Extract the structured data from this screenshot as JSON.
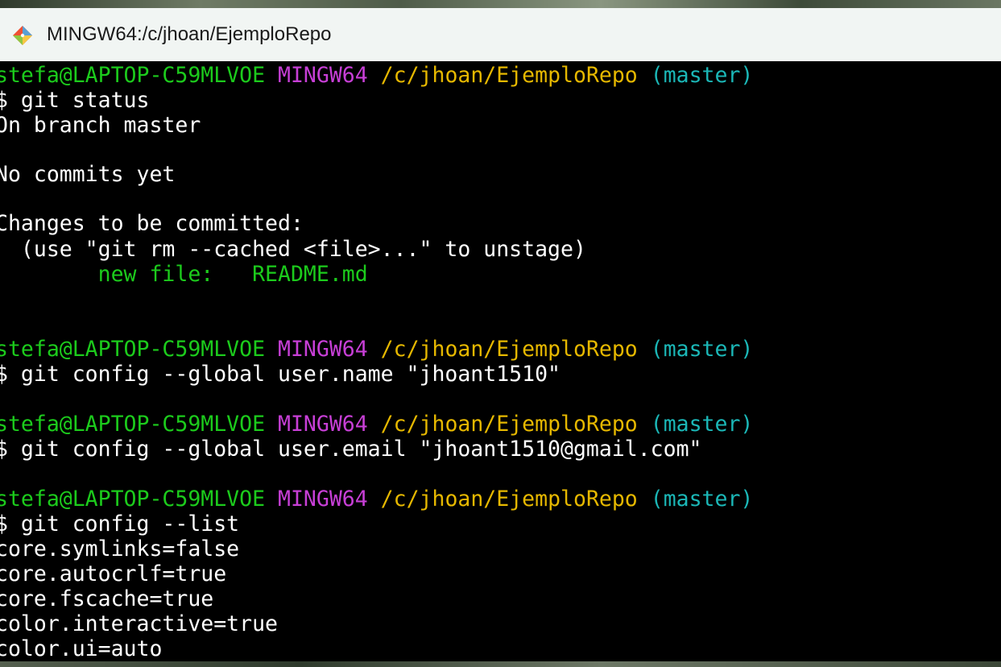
{
  "window": {
    "title": "MINGW64:/c/jhoan/EjemploRepo",
    "icon": "git-bash-icon"
  },
  "colors": {
    "user_host": "#1ccb1c",
    "shell": "#c73fd6",
    "path": "#e6b800",
    "branch": "#1bb7b7",
    "staged_file": "#1ccb1c",
    "text": "#ffffff",
    "background": "#000000"
  },
  "terminal": {
    "prompt1": {
      "user_host": "stefa@LAPTOP-C59MLVOE",
      "shell": "MINGW64",
      "path": "/c/jhoan/EjemploRepo",
      "branch": "(master)"
    },
    "cmd1": "$ git status",
    "out1": "On branch master",
    "out2": "No commits yet",
    "out3": "Changes to be committed:",
    "out4": "  (use \"git rm --cached <file>...\" to unstage)",
    "out5": "        new file:   README.md",
    "prompt2": {
      "user_host": "stefa@LAPTOP-C59MLVOE",
      "shell": "MINGW64",
      "path": "/c/jhoan/EjemploRepo",
      "branch": "(master)"
    },
    "cmd2": "$ git config --global user.name \"jhoant1510\"",
    "prompt3": {
      "user_host": "stefa@LAPTOP-C59MLVOE",
      "shell": "MINGW64",
      "path": "/c/jhoan/EjemploRepo",
      "branch": "(master)"
    },
    "cmd3": "$ git config --global user.email \"jhoant1510@gmail.com\"",
    "prompt4": {
      "user_host": "stefa@LAPTOP-C59MLVOE",
      "shell": "MINGW64",
      "path": "/c/jhoan/EjemploRepo",
      "branch": "(master)"
    },
    "cmd4": "$ git config --list",
    "config_lines": [
      "core.symlinks=false",
      "core.autocrlf=true",
      "core.fscache=true",
      "color.interactive=true",
      "color.ui=auto"
    ]
  }
}
